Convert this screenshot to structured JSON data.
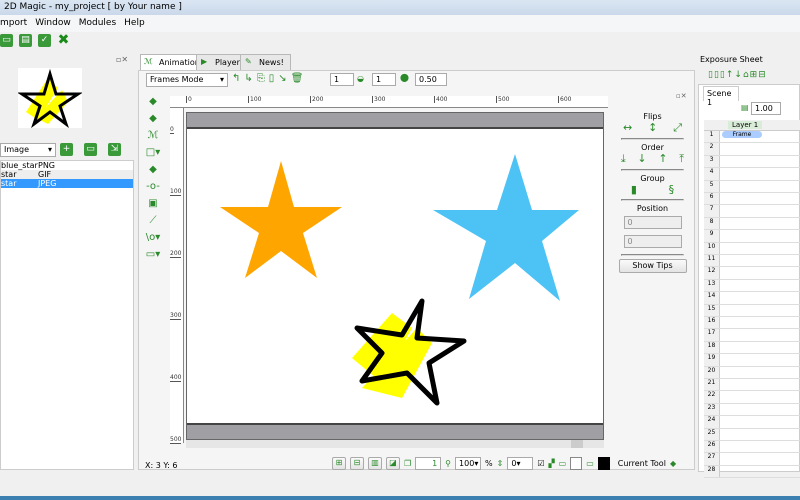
{
  "window": {
    "title": "2D Magic - my_project [ by Your name ]"
  },
  "menu": [
    "mport",
    "Window",
    "Modules",
    "Help"
  ],
  "toolbar_icons": [
    "open-folder-icon",
    "save-icon",
    "save-as-icon",
    "close-x-icon"
  ],
  "library": {
    "type_filter": "Image",
    "items": [
      {
        "name": "blue_star",
        "format": "PNG"
      },
      {
        "name": "star",
        "format": "GIF"
      },
      {
        "name": "star",
        "format": "JPEG",
        "selected": true
      }
    ]
  },
  "tabs": [
    {
      "label": "Animation",
      "active": true
    },
    {
      "label": "Player"
    },
    {
      "label": "News!"
    }
  ],
  "anim_toolbar": {
    "mode": "Frames Mode",
    "spin1": "1",
    "spin2": "1",
    "opacity": "0.50"
  },
  "ruler": {
    "x_ticks": [
      "0",
      "100",
      "200",
      "300",
      "400",
      "500",
      "600"
    ],
    "y_ticks": [
      "0",
      "100",
      "200",
      "300",
      "400",
      "500"
    ]
  },
  "props": {
    "flips": "Flips",
    "order": "Order",
    "group": "Group",
    "position": "Position",
    "pos_x": "0",
    "pos_y": "0",
    "show_tips": "Show Tips"
  },
  "status": {
    "coords": "X: 3 Y: 6",
    "frame": "1",
    "zoom": "100",
    "percent": "%",
    "rotation": "0",
    "current_tool": "Current Tool"
  },
  "exposure": {
    "title": "Exposure Sheet",
    "scene_tab": "Scene 1",
    "scale": "1.00",
    "layer": "Layer 1",
    "frame_label": "Frame",
    "rows": [
      "1",
      "2",
      "3",
      "4",
      "5",
      "6",
      "7",
      "8",
      "9",
      "10",
      "11",
      "12",
      "13",
      "14",
      "15",
      "16",
      "17",
      "18",
      "19",
      "20",
      "21",
      "22",
      "23",
      "24",
      "25",
      "26",
      "27",
      "28"
    ]
  },
  "colors": {
    "accent": "#3a9a3a",
    "orange_star": "#ffa500",
    "blue_star": "#4cc2f5",
    "selection": "#3399ff"
  }
}
